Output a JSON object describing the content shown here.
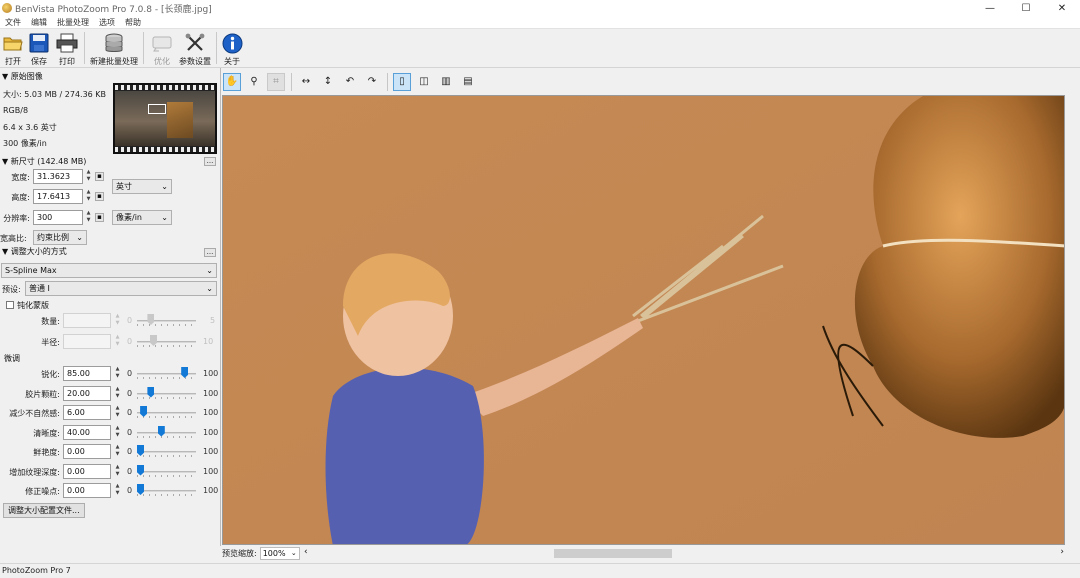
{
  "window": {
    "title": "BenVista PhotoZoom Pro 7.0.8 - [长颈鹿.jpg]",
    "minimize": "—",
    "maximize": "☐",
    "close": "✕"
  },
  "menu": [
    "文件",
    "编辑",
    "批量处理",
    "选项",
    "帮助"
  ],
  "toolbar": [
    {
      "label": "打开",
      "icon": "open-folder-icon"
    },
    {
      "label": "保存",
      "icon": "save-disk-icon"
    },
    {
      "label": "打印",
      "icon": "printer-icon"
    },
    {
      "label": "新建批量处理",
      "icon": "batch-stack-icon"
    },
    {
      "label": "优化",
      "icon": "optimize-icon"
    },
    {
      "label": "参数设置",
      "icon": "tools-icon"
    },
    {
      "label": "关于",
      "icon": "info-icon"
    }
  ],
  "original": {
    "heading": "原始图像",
    "size": "大小: 5.03 MB / 274.36 KB",
    "mode": "RGB/8",
    "dimensions": "6.4 x 3.6 英寸",
    "resolution": "300 像素/in"
  },
  "newsize": {
    "heading": "新尺寸 (142.48 MB)",
    "width_label": "宽度:",
    "width_value": "31.3623",
    "height_label": "高度:",
    "height_value": "17.6413",
    "unit": "英寸",
    "res_label": "分辨率:",
    "res_value": "300",
    "res_unit": "像素/in",
    "aspect_label": "宽高比:",
    "aspect_value": "约束比例"
  },
  "method": {
    "heading": "调整大小的方式",
    "algorithm": "S-Spline Max",
    "preset_label": "预设:",
    "preset_value": "普通 I"
  },
  "unsharp": {
    "heading": "钝化蒙版",
    "rows": [
      {
        "label": "数量:",
        "min": "0",
        "max": "5",
        "fraction": 0.2
      },
      {
        "label": "半径:",
        "min": "0",
        "max": "10",
        "fraction": 0.25
      }
    ]
  },
  "tuning": {
    "heading": "微调",
    "rows": [
      {
        "label": "锐化:",
        "value": "85.00",
        "min": "0",
        "max": "100",
        "fraction": 0.85
      },
      {
        "label": "胶片颗粒:",
        "value": "20.00",
        "min": "0",
        "max": "100",
        "fraction": 0.2
      },
      {
        "label": "减少不自然感:",
        "value": "6.00",
        "min": "0",
        "max": "100",
        "fraction": 0.06
      },
      {
        "label": "清晰度:",
        "value": "40.00",
        "min": "0",
        "max": "100",
        "fraction": 0.4
      },
      {
        "label": "鲜艳度:",
        "value": "0.00",
        "min": "0",
        "max": "100",
        "fraction": 0.0
      },
      {
        "label": "增加纹理深度:",
        "value": "0.00",
        "min": "0",
        "max": "100",
        "fraction": 0.0
      },
      {
        "label": "修正噪点:",
        "value": "0.00",
        "min": "0",
        "max": "100",
        "fraction": 0.0
      }
    ]
  },
  "profile_button": "调整大小配置文件...",
  "more": "...",
  "zoom": {
    "label": "预览缩放:",
    "value": "100%"
  },
  "status": "PhotoZoom Pro 7"
}
